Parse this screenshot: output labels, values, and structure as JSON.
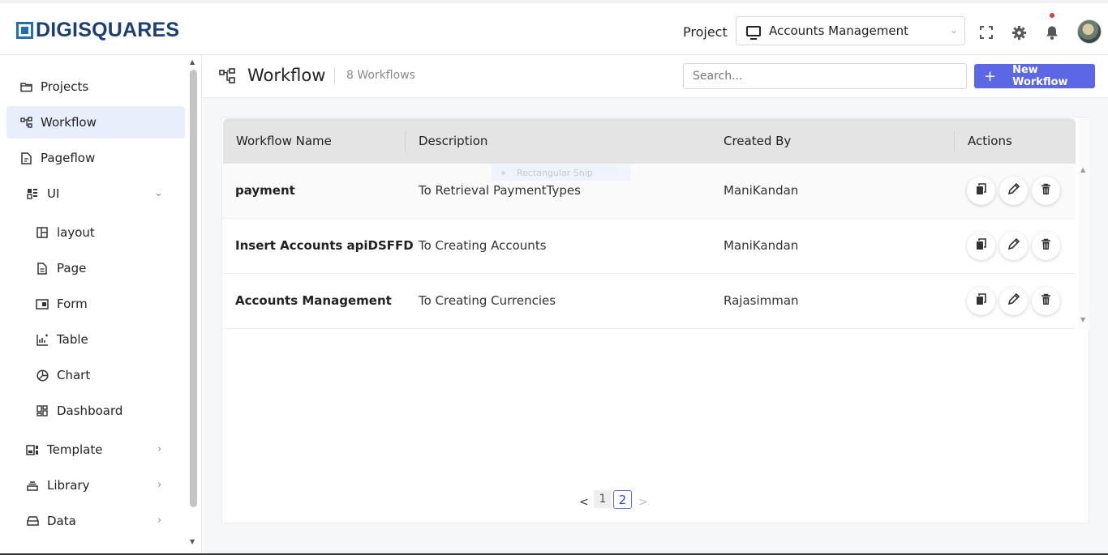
{
  "brand": {
    "name": "DIGISQUARES"
  },
  "header": {
    "project_label": "Project",
    "project_selected": "Accounts Management",
    "icons": [
      "fullscreen-icon",
      "gear-icon",
      "bell-icon",
      "avatar"
    ],
    "has_notification": true
  },
  "sidebar": {
    "items": [
      {
        "label": "Projects",
        "icon": "folder-icon"
      },
      {
        "label": "Workflow",
        "icon": "workflow-icon",
        "active": true
      },
      {
        "label": "Pageflow",
        "icon": "pageflow-icon"
      },
      {
        "label": "UI",
        "icon": "ui-icon",
        "expanded": true
      },
      {
        "label": "layout",
        "icon": "layout-icon"
      },
      {
        "label": "Page",
        "icon": "page-icon"
      },
      {
        "label": "Form",
        "icon": "form-icon"
      },
      {
        "label": "Table",
        "icon": "table-icon"
      },
      {
        "label": "Chart",
        "icon": "chart-icon"
      },
      {
        "label": "Dashboard",
        "icon": "dashboard-icon"
      },
      {
        "label": "Template",
        "icon": "template-icon"
      },
      {
        "label": "Library",
        "icon": "library-icon"
      },
      {
        "label": "Data",
        "icon": "data-icon"
      }
    ]
  },
  "page": {
    "title": "Workflow",
    "count": "8 Workflows",
    "search_placeholder": "Search...",
    "new_button": "New Workflow"
  },
  "table": {
    "columns": [
      "Workflow Name",
      "Description",
      "Created By",
      "Actions"
    ],
    "rows": [
      {
        "name": "payment",
        "description": "To Retrieval PaymentTypes",
        "created_by": "ManiKandan"
      },
      {
        "name": "Insert Accounts apiDSFFD",
        "description": "To Creating Accounts",
        "created_by": "ManiKandan"
      },
      {
        "name": "Accounts Management",
        "description": "To Creating Currencies",
        "created_by": "Rajasimman"
      }
    ],
    "row_actions": [
      "copy-icon",
      "edit-icon",
      "delete-icon"
    ]
  },
  "overlay": {
    "ghost_label": "Rectangular Snip"
  },
  "pagination": {
    "pages": [
      "1",
      "2"
    ],
    "current": "2",
    "prev": "<",
    "next": ">"
  },
  "colors": {
    "brand": "#1d3f73",
    "accent": "#5c67e5",
    "active_bg": "#e9eefc",
    "notification": "#e53935"
  }
}
